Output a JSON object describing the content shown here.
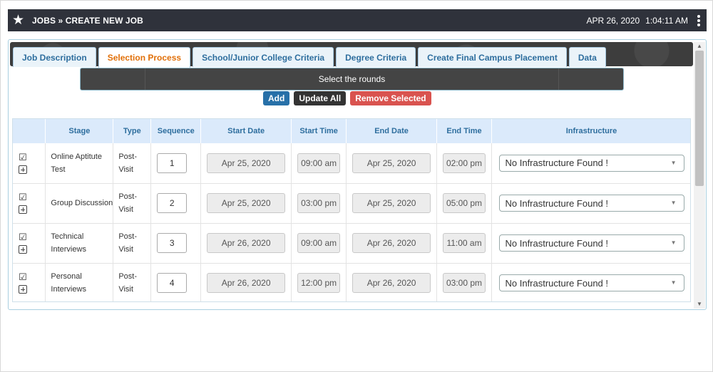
{
  "header": {
    "title": "JOBS » CREATE NEW JOB",
    "date": "APR 26, 2020",
    "time": "1:04:11 AM"
  },
  "icons": {
    "star": "star-icon",
    "menu": "kebab-menu-icon",
    "check": "checkbox-checked-icon",
    "expand": "plus-square-icon",
    "dropdown": "caret-down-icon"
  },
  "tabs": [
    {
      "label": "Job Description"
    },
    {
      "label": "Selection Process",
      "active": true
    },
    {
      "label": "School/Junior College Criteria"
    },
    {
      "label": "Degree Criteria"
    },
    {
      "label": "Create Final Campus Placement"
    },
    {
      "label": "Data"
    }
  ],
  "rounds_label": "Select the rounds",
  "actions": {
    "add": "Add",
    "update_all": "Update All",
    "remove_selected": "Remove Selected"
  },
  "table": {
    "columns": [
      "Stage",
      "Type",
      "Sequence",
      "Start Date",
      "Start Time",
      "End Date",
      "End Time",
      "Infrastructure"
    ],
    "rows": [
      {
        "stage": "Online Aptitute Test",
        "type": "Post-Visit",
        "sequence": "1",
        "start_date": "Apr 25, 2020",
        "start_time": "09:00 am",
        "end_date": "Apr 25, 2020",
        "end_time": "02:00 pm",
        "infrastructure": "No Infrastructure Found !"
      },
      {
        "stage": "Group Discussion",
        "type": "Post-Visit",
        "sequence": "2",
        "start_date": "Apr 25, 2020",
        "start_time": "03:00 pm",
        "end_date": "Apr 25, 2020",
        "end_time": "05:00 pm",
        "infrastructure": "No Infrastructure Found !"
      },
      {
        "stage": "Technical Interviews",
        "type": "Post-Visit",
        "sequence": "3",
        "start_date": "Apr 26, 2020",
        "start_time": "09:00 am",
        "end_date": "Apr 26, 2020",
        "end_time": "11:00 am",
        "infrastructure": "No Infrastructure Found !"
      },
      {
        "stage": "Personal Interviews",
        "type": "Post-Visit",
        "sequence": "4",
        "start_date": "Apr 26, 2020",
        "start_time": "12:00 pm",
        "end_date": "Apr 26, 2020",
        "end_time": "03:00 pm",
        "infrastructure": "No Infrastructure Found !"
      }
    ]
  },
  "colors": {
    "header_bg": "#2f323b",
    "tab_text": "#2e6e9e",
    "active_tab_text": "#e17009",
    "add_btn": "#2770a8",
    "update_btn": "#333333",
    "remove_btn": "#d9534f",
    "table_header_bg": "#dbeafb"
  }
}
